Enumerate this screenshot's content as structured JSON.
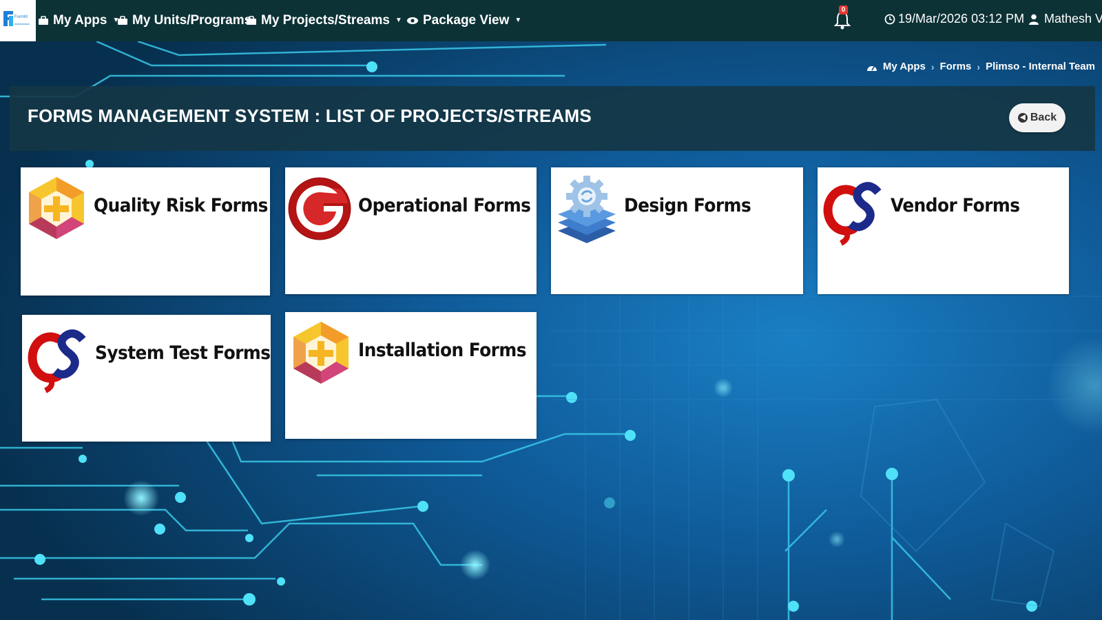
{
  "nav": {
    "logo_text": "FormM",
    "items": [
      {
        "label": "My Apps",
        "has_caret": true
      },
      {
        "label": "My Units/Programs",
        "has_caret": false
      },
      {
        "label": "My Projects/Streams",
        "has_caret": true
      },
      {
        "label": "Package View",
        "has_caret": true
      }
    ],
    "notification_count": "0",
    "datetime": "19/Mar/2026 03:12 PM",
    "user_name": "Mathesh V"
  },
  "breadcrumb": {
    "items": [
      "My Apps",
      "Forms",
      "Plimso - Internal Team"
    ]
  },
  "header": {
    "title": "FORMS MANAGEMENT SYSTEM : LIST OF PROJECTS/STREAMS",
    "back_label": "Back"
  },
  "cards": [
    {
      "label": "Quality Risk Forms",
      "icon": "hexagon-plus-icon"
    },
    {
      "label": "Operational Forms",
      "icon": "red-g-logo-icon"
    },
    {
      "label": "Design Forms",
      "icon": "gear-layers-icon"
    },
    {
      "label": "Vendor Forms",
      "icon": "cs-logo-icon"
    },
    {
      "label": "System Test Forms",
      "icon": "cs-logo-icon"
    },
    {
      "label": "Installation Forms",
      "icon": "hexagon-plus-icon"
    }
  ],
  "colors": {
    "topbar": "#0d3236",
    "background": "#0a3d6b",
    "accent_cyan": "#35d6f0",
    "card": "#ffffff"
  }
}
